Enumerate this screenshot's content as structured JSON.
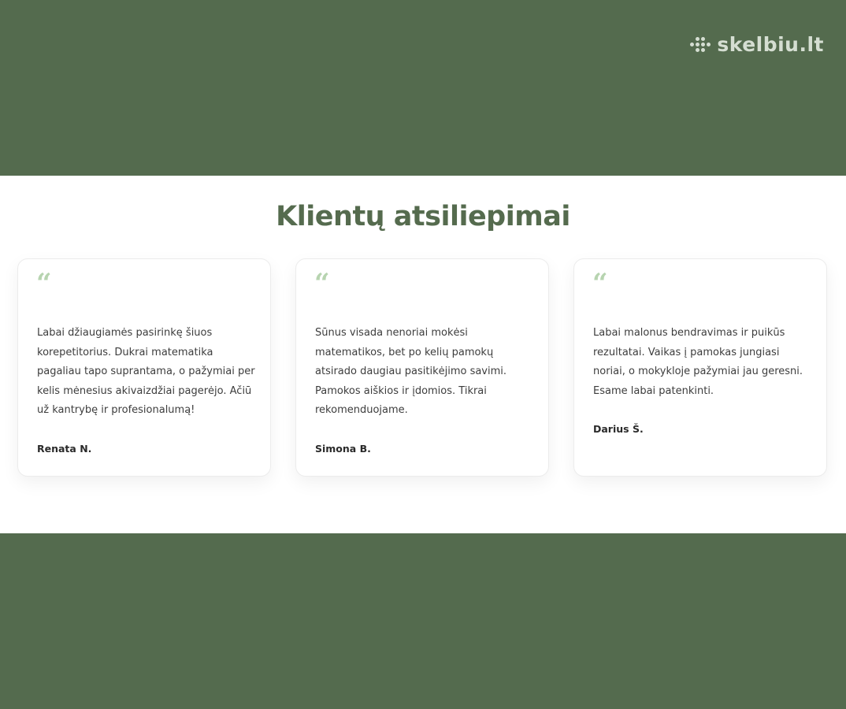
{
  "header": {
    "logo_text": "skelbiu.lt",
    "logo_icon": "dots-grid-icon"
  },
  "section": {
    "title": "Klientų atsiliepimai",
    "quote_icon": "quote-icon",
    "quote_symbol": "“",
    "testimonials": [
      {
        "text": "Labai džiaugiamės pasirinkę šiuos korepetitorius. Dukrai matematika pagaliau tapo suprantama, o pažymiai per kelis mėnesius akivaizdžiai pagerėjo. Ačiū už kantrybę ir profesionalumą!",
        "author": "Renata N."
      },
      {
        "text": "Sūnus visada nenoriai mokėsi matematikos, bet po kelių pamokų atsirado daugiau pasitikėjimo savimi. Pamokos aiškios ir įdomios. Tikrai rekomenduojame.",
        "author": "Simona B."
      },
      {
        "text": "Labai malonus bendravimas ir puikūs rezultatai. Vaikas į pamokas jungiasi noriai, o mokykloje pažymiai jau geresni. Esame labai patenkinti.",
        "author": "Darius Š."
      }
    ]
  },
  "colors": {
    "background_green": "#546b4e",
    "heading_green": "#556b4e",
    "quote_green": "#b7d4b0"
  }
}
